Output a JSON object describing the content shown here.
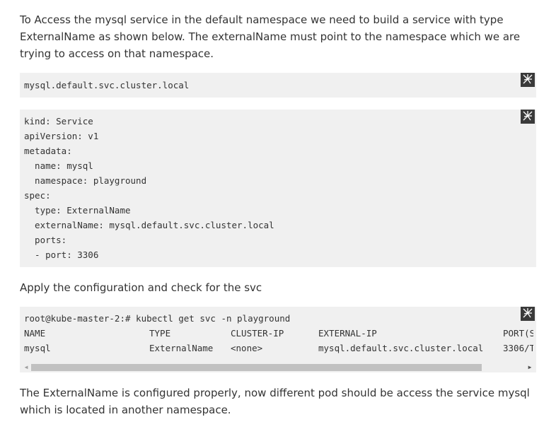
{
  "intro_text": "To Access the mysql service in the default namespace we need to build a service with type ExternalName as shown below. The externalName must point to the namespace which we are trying to access on that namespace.",
  "block1": {
    "lines": [
      "mysql.default.svc.cluster.local"
    ]
  },
  "block2": {
    "lines": [
      "kind: Service",
      "apiVersion: v1",
      "metadata:",
      "  name: mysql",
      "  namespace: playground",
      "spec:",
      "  type: ExternalName",
      "  externalName: mysql.default.svc.cluster.local",
      "  ports:",
      "  - port: 3306"
    ]
  },
  "apply_text": "Apply the configuration and check for the svc",
  "block3": {
    "command": "root@kube-master-2:# kubectl get svc -n playground",
    "headers": [
      "NAME",
      "TYPE",
      "CLUSTER-IP",
      "EXTERNAL-IP",
      "PORT(S"
    ],
    "row": [
      "mysql",
      "ExternalName",
      "<none>",
      "mysql.default.svc.cluster.local",
      "3306/T"
    ]
  },
  "final_text": "The ExternalName is configured properly, now different pod should be access the service mysql which is located in another namespace.",
  "icons": {
    "copy": "copy-icon",
    "scroll_left": "arrow-left-icon",
    "scroll_right": "arrow-right-icon"
  },
  "colors": {
    "code_bg": "#f0f0f0",
    "text": "#333333",
    "copy_btn_bg": "#3a3a3a",
    "scroll_thumb": "#c1c1c1"
  }
}
